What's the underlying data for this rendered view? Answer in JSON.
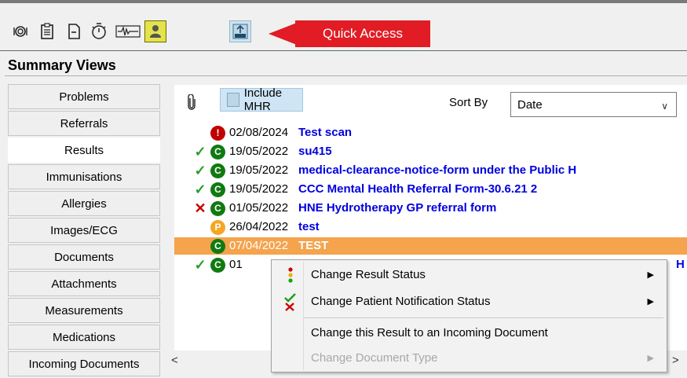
{
  "toolbar": {
    "icons": [
      {
        "name": "camera-icon"
      },
      {
        "name": "clipboard-icon"
      },
      {
        "name": "document-icon"
      },
      {
        "name": "timer-icon"
      },
      {
        "name": "waveform-icon"
      },
      {
        "name": "patient-icon"
      },
      {
        "name": "mhr-icon"
      }
    ]
  },
  "callout": {
    "label": "Quick Access",
    "color": "#e11c24"
  },
  "summary": {
    "title": "Summary Views"
  },
  "sidebar": {
    "items": [
      {
        "label": "Problems"
      },
      {
        "label": "Referrals"
      },
      {
        "label": "Results",
        "active": true
      },
      {
        "label": "Immunisations"
      },
      {
        "label": "Allergies"
      },
      {
        "label": "Images/ECG"
      },
      {
        "label": "Documents"
      },
      {
        "label": "Attachments"
      },
      {
        "label": "Measurements"
      },
      {
        "label": "Medications"
      },
      {
        "label": "Incoming Documents"
      }
    ]
  },
  "controls": {
    "include_mhr": "Include MHR",
    "sort_label": "Sort By",
    "sort_value": "Date"
  },
  "results": [
    {
      "status": "none",
      "badge": "!",
      "badge_color": "#c00000",
      "date": "02/08/2024",
      "name": "Test scan"
    },
    {
      "status": "check",
      "badge": "C",
      "badge_color": "#107a10",
      "date": "19/05/2022",
      "name": "su415"
    },
    {
      "status": "check",
      "badge": "C",
      "badge_color": "#107a10",
      "date": "19/05/2022",
      "name": "medical-clearance-notice-form under the Public H"
    },
    {
      "status": "check",
      "badge": "C",
      "badge_color": "#107a10",
      "date": "19/05/2022",
      "name": "CCC Mental Health Referral Form-30.6.21 2"
    },
    {
      "status": "cross",
      "badge": "C",
      "badge_color": "#107a10",
      "date": "01/05/2022",
      "name": "HNE Hydrotherapy GP referral form"
    },
    {
      "status": "none",
      "badge": "P",
      "badge_color": "#f5a623",
      "date": "26/04/2022",
      "name": "test"
    },
    {
      "status": "none",
      "badge": "C",
      "badge_color": "#107a10",
      "date": "07/04/2022",
      "name": "TEST",
      "selected": true
    },
    {
      "status": "check",
      "badge": "C",
      "badge_color": "#107a10",
      "date": "01",
      "name": "H"
    }
  ],
  "context_menu": {
    "items": [
      {
        "label": "Change Result Status",
        "submenu": true
      },
      {
        "label": "Change Patient Notification Status",
        "submenu": true
      },
      {
        "label": "Change this Result to an Incoming Document",
        "submenu": false
      },
      {
        "label": "Change Document Type",
        "submenu": true,
        "disabled": true
      }
    ]
  },
  "scroll": {
    "left_arrow": "<",
    "right_arrow": ">"
  },
  "colors": {
    "link": "#0000e0",
    "check": "#2a9d2a",
    "cross": "#c00000",
    "selection": "#f5a34d"
  }
}
